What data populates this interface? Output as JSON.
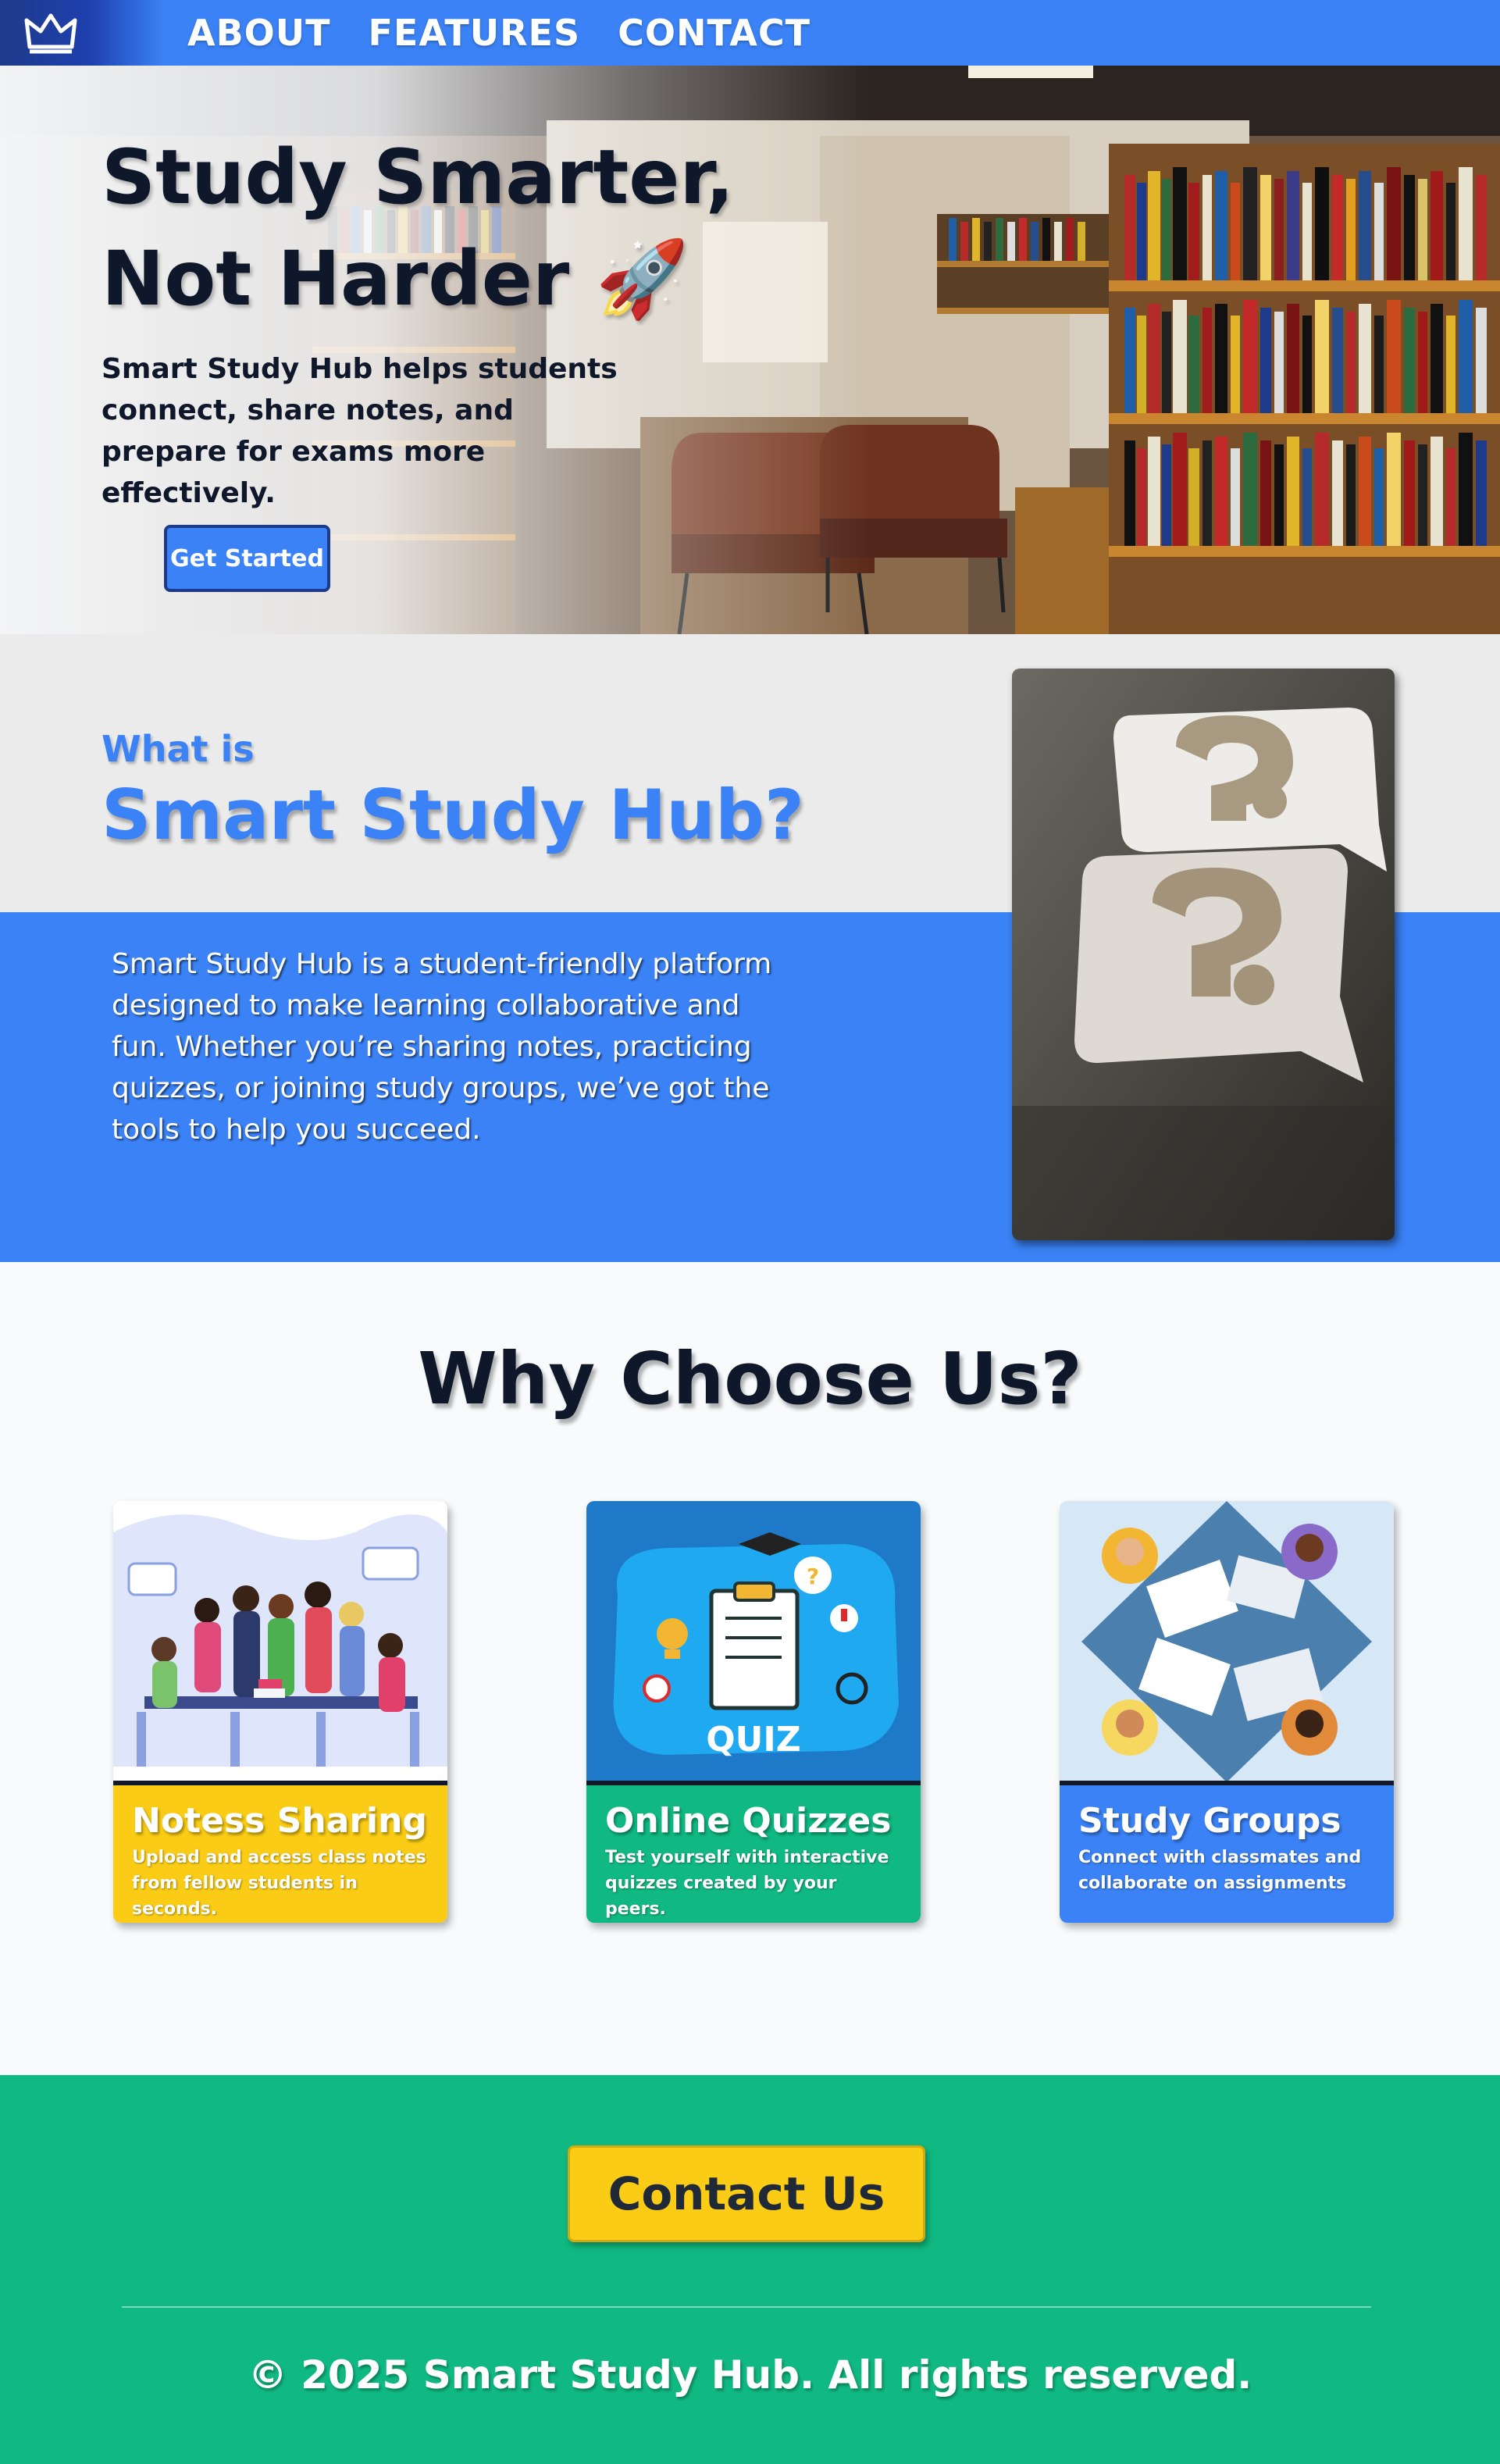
{
  "nav": {
    "logo_icon": "crown-icon",
    "links": [
      "ABOUT",
      "FEATURES",
      "CONTACT"
    ]
  },
  "hero": {
    "title_line1": "Study Smarter,",
    "title_line2": "Not Harder",
    "title_emoji": "🚀",
    "description": "Smart Study Hub helps students connect, share notes, and prepare for exams more effectively.",
    "cta_label": "Get Started",
    "background": "library-bookshelves-photo"
  },
  "about": {
    "kicker": "What is",
    "title": "Smart Study Hub?",
    "text": "Smart Study Hub is a student-friendly platform designed to make learning collaborative and fun. Whether you’re sharing notes, practicing quizzes, or joining study groups, we’ve got the tools to help you succeed.",
    "image": "question-mark-speech-bubbles-photo"
  },
  "why": {
    "title": "Why Choose Us?",
    "cards": [
      {
        "title": "Notess Sharing",
        "desc_line1": "Upload and access class notes",
        "desc_line2": "from fellow students in seconds.",
        "color": "#facc15",
        "art": "group-of-students-illustration"
      },
      {
        "title": "Online Quizzes",
        "desc_line1": "Test yourself with interactive",
        "desc_line2": "quizzes created by your peers.",
        "color": "#10b981",
        "art": "quiz-clipboard-illustration",
        "art_text": "QUIZ"
      },
      {
        "title": "Study Groups",
        "desc_line1": "Connect with classmates and",
        "desc_line2": "collaborate on assignments",
        "color": "#3b82f6",
        "art": "people-around-table-illustration"
      }
    ]
  },
  "footer": {
    "contact_label": "Contact Us",
    "copyright": "© 2025 Smart Study Hub. All rights reserved."
  },
  "colors": {
    "primary_blue": "#3b82f6",
    "green": "#10b981",
    "yellow": "#facc15",
    "dark": "#0f172a"
  }
}
